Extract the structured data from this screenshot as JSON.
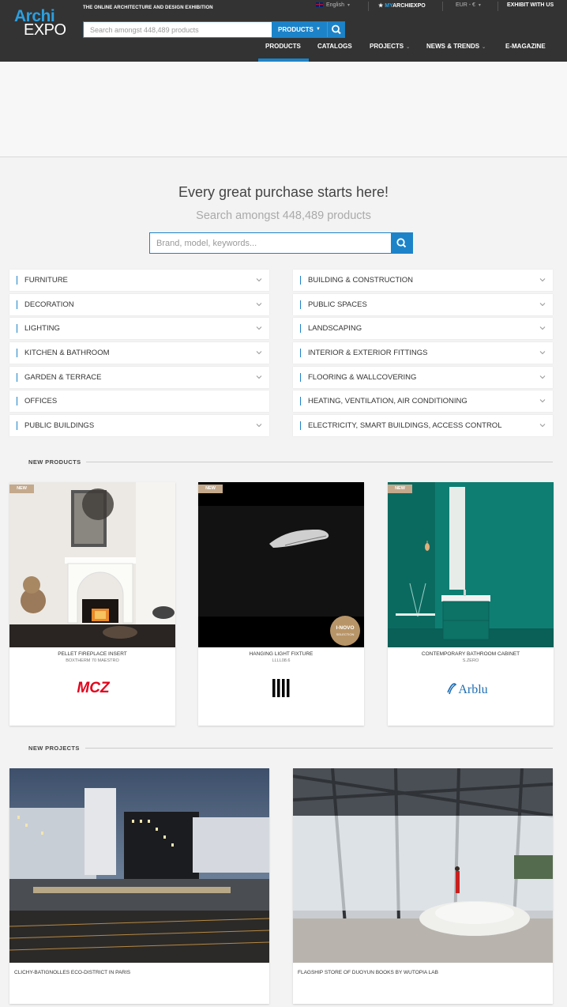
{
  "header": {
    "logo_archi": "Archi",
    "logo_expo": "EXPO",
    "tagline": "THE ONLINE ARCHITECTURE AND DESIGN EXHIBITION",
    "language": "English",
    "my_prefix": "MY",
    "my_brand": "ARCHIEXPO",
    "currency": "EUR - €",
    "exhibit": "EXHIBIT WITH US",
    "search_placeholder": "Search amongst 448,489 products",
    "search_category": "PRODUCTS",
    "nav": [
      {
        "label": "PRODUCTS"
      },
      {
        "label": "CATALOGS"
      },
      {
        "label": "PROJECTS"
      },
      {
        "label": "NEWS & TRENDS"
      },
      {
        "label": "E-MAGAZINE"
      }
    ]
  },
  "hero": {
    "title": "Every great purchase starts here!",
    "subtitle": "Search amongst 448,489 products",
    "placeholder": "Brand, model, keywords..."
  },
  "categories": {
    "left": [
      {
        "label": "FURNITURE"
      },
      {
        "label": "DECORATION"
      },
      {
        "label": "LIGHTING"
      },
      {
        "label": "KITCHEN & BATHROOM"
      },
      {
        "label": "GARDEN & TERRACE"
      },
      {
        "label": "OFFICES"
      },
      {
        "label": "PUBLIC BUILDINGS"
      }
    ],
    "right": [
      {
        "label": "BUILDING & CONSTRUCTION"
      },
      {
        "label": "PUBLIC SPACES"
      },
      {
        "label": "LANDSCAPING"
      },
      {
        "label": "INTERIOR & EXTERIOR FITTINGS"
      },
      {
        "label": "FLOORING & WALLCOVERING"
      },
      {
        "label": "HEATING, VENTILATION, AIR CONDITIONING"
      },
      {
        "label": "ELECTRICITY, SMART BUILDINGS, ACCESS CONTROL"
      }
    ]
  },
  "new_products": {
    "heading": "NEW PRODUCTS",
    "badge": "NEW",
    "items": [
      {
        "name": "PELLET FIREPLACE INSERT",
        "model": "BOXTHERM 70 MAESTRO",
        "brand": "MCZ"
      },
      {
        "name": "HANGING LIGHT FIXTURE",
        "model": "LLLL08.6",
        "brand": "IIII",
        "award": "I-NOVO SELECTION"
      },
      {
        "name": "CONTEMPORARY BATHROOM CABINET",
        "model": "S.ZERO",
        "brand": "Arblu"
      }
    ]
  },
  "new_projects": {
    "heading": "NEW PROJECTS",
    "items": [
      {
        "name": "CLICHY-BATIGNOLLES ECO-DISTRICT IN PARIS"
      },
      {
        "name": "FLAGSHIP STORE OF DUOYUN BOOKS BY WUTOPIA LAB"
      }
    ]
  },
  "colors": {
    "accent": "#1c83c9",
    "header_bg": "#333333",
    "new_badge": "#c4a98c",
    "mcz_red": "#e2001a",
    "arblu_blue": "#1c6db3"
  }
}
